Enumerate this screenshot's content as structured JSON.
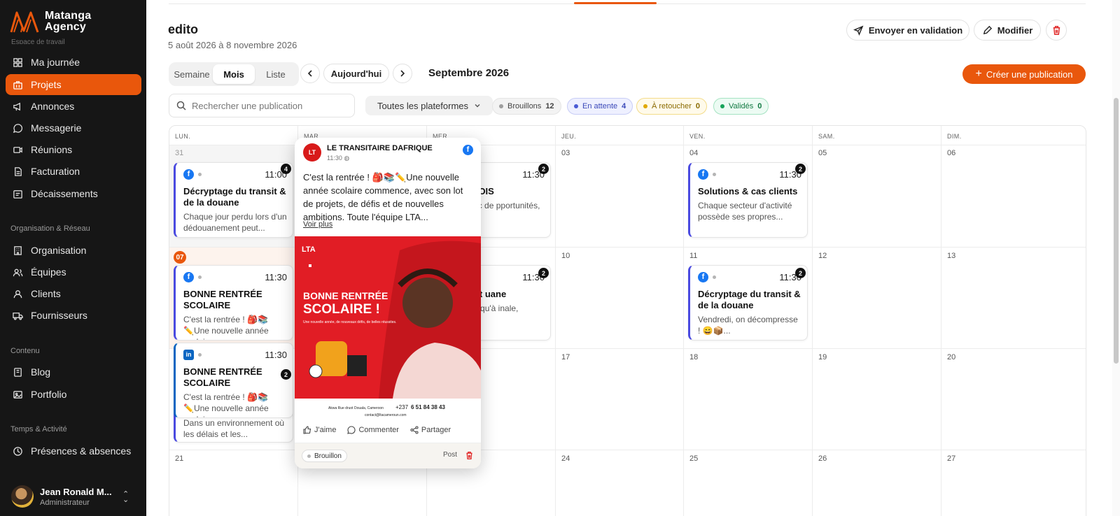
{
  "brand": {
    "name_line1": "Matanga",
    "name_line2": "Agency",
    "cut_section": "Espace de travail"
  },
  "sidebar": {
    "items": [
      {
        "label": "Ma journée",
        "icon": "grid-icon"
      },
      {
        "label": "Projets",
        "icon": "briefcase-icon",
        "active": true
      },
      {
        "label": "Annonces",
        "icon": "megaphone-icon"
      },
      {
        "label": "Messagerie",
        "icon": "chat-icon"
      },
      {
        "label": "Réunions",
        "icon": "video-icon"
      },
      {
        "label": "Facturation",
        "icon": "invoice-icon"
      },
      {
        "label": "Décaissements",
        "icon": "wallet-icon"
      },
      {
        "label": "Organisation",
        "icon": "building-icon"
      },
      {
        "label": "Équipes",
        "icon": "users-icon"
      },
      {
        "label": "Clients",
        "icon": "user-icon"
      },
      {
        "label": "Fournisseurs",
        "icon": "truck-icon"
      },
      {
        "label": "Blog",
        "icon": "book-icon"
      },
      {
        "label": "Portfolio",
        "icon": "image-icon"
      },
      {
        "label": "Présences & absences",
        "icon": "clock-icon"
      }
    ],
    "sections": [
      "Organisation & Réseau",
      "Contenu",
      "Temps & Activité"
    ],
    "user": {
      "name": "Jean Ronald M...",
      "role": "Administrateur"
    }
  },
  "header": {
    "title": "edito",
    "dates": "5 août 2026 à 8 novembre 2026",
    "send_validation": "Envoyer en validation",
    "modify": "Modifier"
  },
  "toolbar": {
    "views": [
      "Semaine",
      "Mois",
      "Liste"
    ],
    "active_view": "Mois",
    "today": "Aujourd'hui",
    "month": "Septembre 2026",
    "create": "Créer une publication"
  },
  "filters": {
    "search_placeholder": "Rechercher une publication",
    "platforms": "Toutes les plateformes",
    "status": [
      {
        "label": "Brouillons",
        "count": "12",
        "color": "#9e9e9e"
      },
      {
        "label": "En attente",
        "count": "4",
        "color": "#4a5bd4"
      },
      {
        "label": "À retoucher",
        "count": "0",
        "color": "#e0a800"
      },
      {
        "label": "Validés",
        "count": "0",
        "color": "#17a35a"
      }
    ]
  },
  "calendar": {
    "days": [
      "LUN.",
      "MAR.",
      "MER.",
      "JEU.",
      "VEN.",
      "SAM.",
      "DIM."
    ],
    "weeks": [
      [
        "31",
        "",
        "",
        "03",
        "04",
        "05",
        "06"
      ],
      [
        "07",
        "",
        "",
        "10",
        "11",
        "12",
        "13"
      ],
      [
        "",
        "",
        "",
        "17",
        "18",
        "19",
        "20"
      ],
      [
        "21",
        "",
        "",
        "24",
        "25",
        "26",
        "27"
      ]
    ],
    "cards": {
      "mon31": {
        "time": "11:00",
        "count": "4",
        "title": "Décryptage du transit & de la douane",
        "excerpt": "Chaque jour perdu lors d'un dédouanement peut..."
      },
      "wed02": {
        "time": "11:30",
        "count": "2",
        "title": "UT DE MOIS",
        "excerpt": "ouvre avec de pportunités, d..."
      },
      "fri04": {
        "time": "11:30",
        "count": "2",
        "title": "Solutions & cas clients",
        "excerpt": "Chaque secteur d'activité possède ses propres..."
      },
      "mon07a": {
        "time": "11:30",
        "title": "BONNE RENTRÉE SCOLAIRE",
        "excerpt": "C'est la rentrée ! 🎒📚✏️Une nouvelle année scolaire..."
      },
      "mon07b": {
        "time": "11:30",
        "count": "2",
        "title": "BONNE RENTRÉE SCOLAIRE",
        "excerpt": "C'est la rentrée ! 🎒📚✏️Une nouvelle année scolaire..."
      },
      "mon07c": {
        "excerpt": "Dans un environnement où les délais et les..."
      },
      "wed09": {
        "time": "11:30",
        "count": "2",
        "title": "du transit uane",
        "excerpt": "au port jusqu'à inale, chaque..."
      },
      "fri11": {
        "time": "11:30",
        "count": "2",
        "title": "Décryptage du transit & de la douane",
        "excerpt": "Vendredi, on décompresse ! 😄📦..."
      }
    }
  },
  "popover": {
    "page_name": "LE TRANSITAIRE DAFRIQUE",
    "logo_text": "LT",
    "time": "11:30",
    "text": "C'est la rentrée ! 🎒📚✏️Une nouvelle année scolaire commence, avec son lot de projets, de défis et de nouvelles ambitions. Toute l'équipe LTA...",
    "more": "Voir plus",
    "image": {
      "brand": "LTA",
      "headline1": "BONNE RENTRÉE",
      "headline2": "SCOLAIRE !",
      "sub": "Une nouvelle année, de nouveaux défis, de belles réussites.",
      "address": "Akwa Rue druot Douala, Cameroon",
      "phone_prefix": "+237",
      "phone": "6 51 84 38 43",
      "email": "contact@ltacameroun.com"
    },
    "like": "J'aime",
    "comment": "Commenter",
    "share": "Partager",
    "status": "Brouillon",
    "type": "Post"
  },
  "colors": {
    "accent": "#e9570c",
    "sidebar": "#161616",
    "facebook": "#1877f2",
    "linkedin": "#0a66c2"
  }
}
